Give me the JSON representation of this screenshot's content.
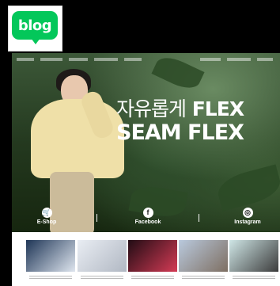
{
  "logo": {
    "text": "blog",
    "icon": "speech-bubble-icon",
    "color": "#03c75a"
  },
  "banner": {
    "headline_line1_prefix": "자유롭게",
    "headline_line1_suffix": "FLEX",
    "headline_line2": "SEAM FLEX",
    "links": [
      {
        "label": "E-Shop",
        "icon": "cart-icon",
        "glyph": "🛒"
      },
      {
        "label": "Facebook",
        "icon": "facebook-icon",
        "glyph": "f"
      },
      {
        "label": "Instagram",
        "icon": "instagram-icon",
        "glyph": "◎"
      }
    ]
  },
  "gallery": {
    "items": [
      {
        "thumb_colors": [
          "#1e3556",
          "#dfe6ef"
        ]
      },
      {
        "thumb_colors": [
          "#e9edf3",
          "#b1b8c3"
        ]
      },
      {
        "thumb_colors": [
          "#210c14",
          "#d43b55"
        ]
      },
      {
        "thumb_colors": [
          "#b9c9dd",
          "#7e6f62"
        ]
      },
      {
        "thumb_colors": [
          "#cfe6e6",
          "#3b3b3b"
        ]
      }
    ]
  }
}
